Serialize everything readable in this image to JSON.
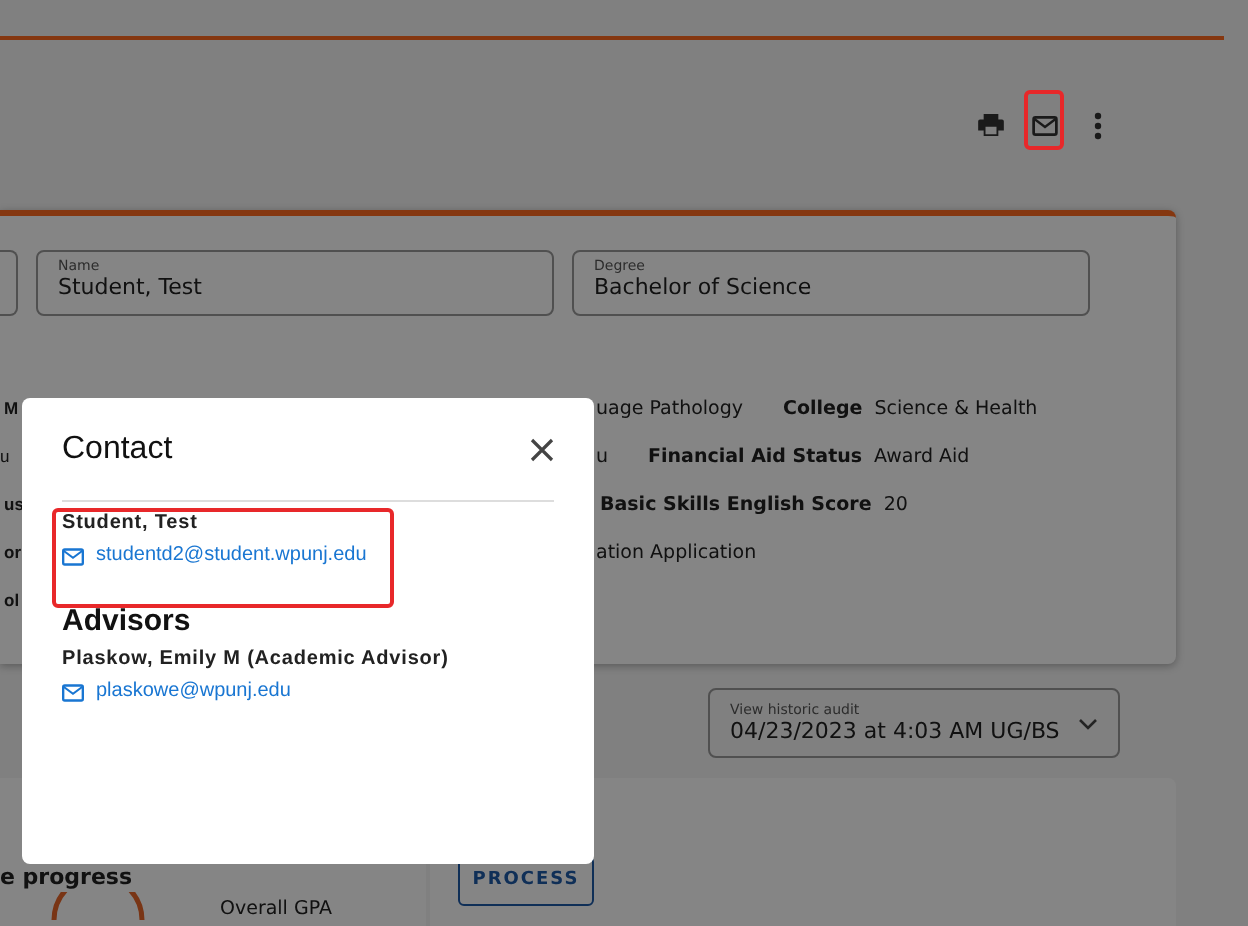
{
  "student_card": {
    "fields": [
      {
        "label": "Name",
        "value": "Student, Test"
      },
      {
        "label": "Degree",
        "value": "Bachelor of Science"
      }
    ],
    "info_rows": [
      {
        "left": {
          "text": "M",
          "kind": "label"
        },
        "right": [
          {
            "text": "uage Pathology",
            "kind": "value"
          },
          {
            "text": "College",
            "kind": "label"
          },
          {
            "text": "Science & Health",
            "kind": "value"
          }
        ]
      },
      {
        "left": {
          "text": "u",
          "kind": "value"
        },
        "right": [
          {
            "text": "u",
            "kind": "value"
          },
          {
            "text": "Financial Aid Status",
            "kind": "label"
          },
          {
            "text": "Award Aid",
            "kind": "value"
          }
        ]
      },
      {
        "left": {
          "text": "us",
          "kind": "label"
        },
        "right": [
          {
            "text": "Basic Skills English Score",
            "kind": "label"
          },
          {
            "text": "20",
            "kind": "value"
          }
        ]
      },
      {
        "left": {
          "text": "or",
          "kind": "label"
        },
        "right": [
          {
            "text": "ation Application",
            "kind": "value"
          }
        ]
      },
      {
        "left": {
          "text": "ol",
          "kind": "label"
        },
        "right": []
      }
    ]
  },
  "audit_select": {
    "label": "View historic audit",
    "value": "04/23/2023 at 4:03 AM UG/BS"
  },
  "progress_card": {
    "title": "e progress",
    "gpa_label": "Overall GPA"
  },
  "process_button": "PROCESS",
  "contact_dialog": {
    "title": "Contact",
    "student": {
      "name": "Student, Test",
      "email": "studentd2@student.wpunj.edu"
    },
    "advisors_heading": "Advisors",
    "advisors": [
      {
        "name": "Plaskow, Emily M (Academic Advisor)",
        "email": "plaskowe@wpunj.edu"
      }
    ]
  }
}
